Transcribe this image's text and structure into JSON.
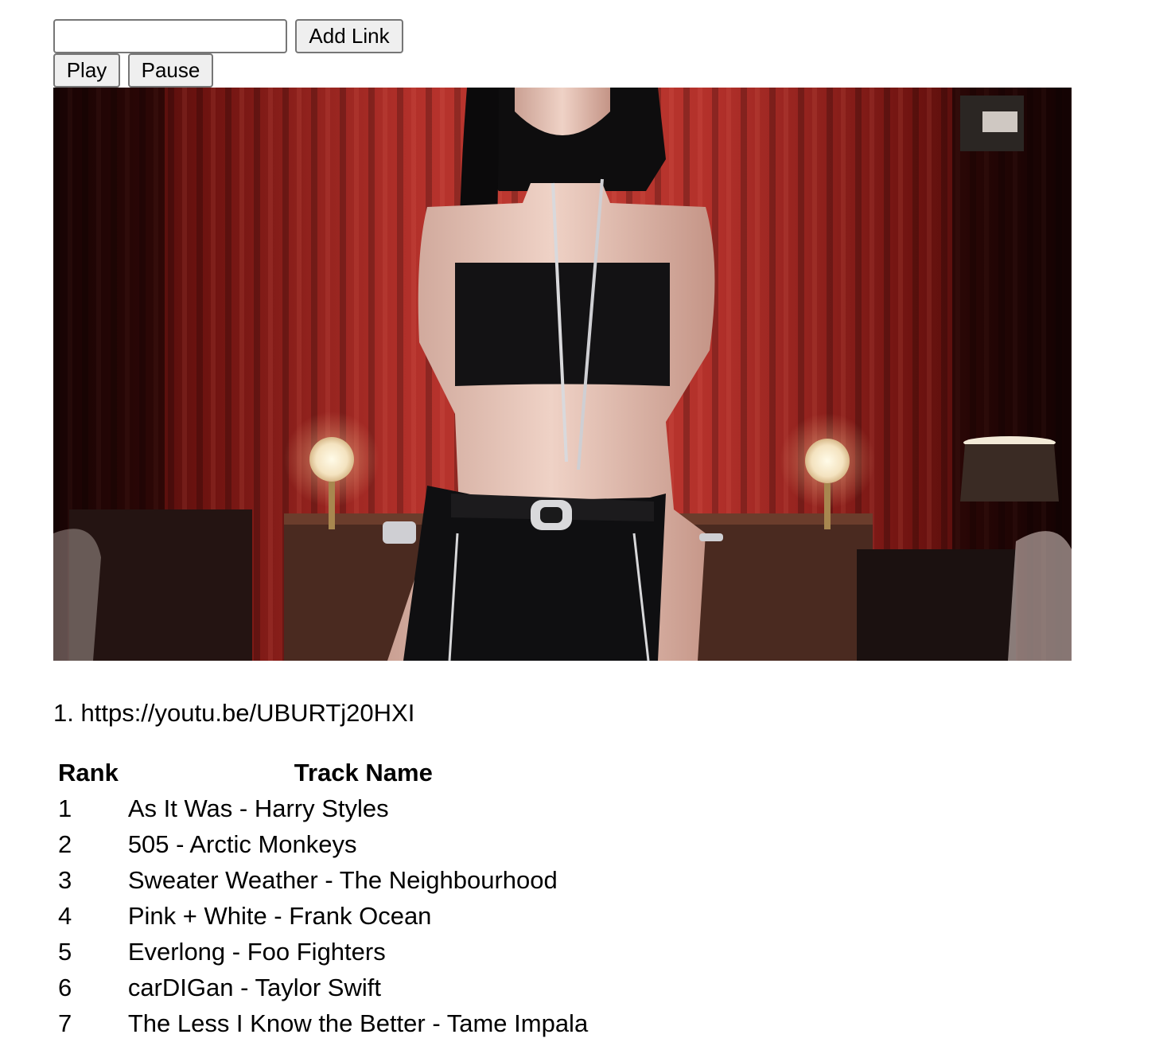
{
  "controls": {
    "link_input_value": "",
    "add_link_label": "Add Link",
    "play_label": "Play",
    "pause_label": "Pause"
  },
  "playlist": [
    {
      "number": "1.",
      "url": "https://youtu.be/UBURTj20HXI"
    }
  ],
  "tracks": {
    "headers": {
      "rank": "Rank",
      "name": "Track Name"
    },
    "rows": [
      {
        "rank": "1",
        "name": "As It Was - Harry Styles"
      },
      {
        "rank": "2",
        "name": "505 - Arctic Monkeys"
      },
      {
        "rank": "3",
        "name": "Sweater Weather - The Neighbourhood"
      },
      {
        "rank": "4",
        "name": "Pink + White - Frank Ocean"
      },
      {
        "rank": "5",
        "name": "Everlong - Foo Fighters"
      },
      {
        "rank": "6",
        "name": "carDIGan - Taylor Swift"
      },
      {
        "rank": "7",
        "name": "The Less I Know the Better - Tame Impala"
      }
    ]
  }
}
